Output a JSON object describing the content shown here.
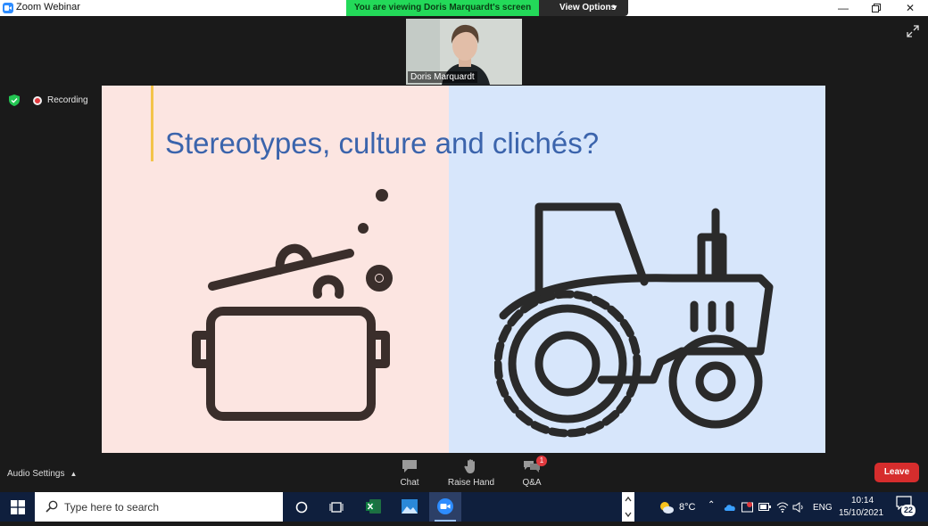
{
  "window": {
    "title": "Zoom Webinar"
  },
  "banner": {
    "viewing_text": "You are viewing Doris Marquardt's screen",
    "view_options_label": "View Options"
  },
  "speaker": {
    "name": "Doris Marquardt"
  },
  "recording": {
    "label": "Recording"
  },
  "slide": {
    "title": "Stereotypes, culture and clichés?"
  },
  "toolbar": {
    "audio_settings_label": "Audio Settings",
    "chat_label": "Chat",
    "raise_hand_label": "Raise Hand",
    "qa_label": "Q&A",
    "qa_badge": "1",
    "leave_label": "Leave"
  },
  "taskbar": {
    "search_placeholder": "Type here to search",
    "weather": "8°C",
    "language": "ENG",
    "time": "10:14",
    "date": "15/10/2021",
    "notification_count": "22"
  },
  "colors": {
    "banner_green": "#23d959",
    "slide_left_bg": "#fce5e1",
    "slide_right_bg": "#d7e6fb",
    "slide_title": "#3b64ac",
    "accent_bar": "#f3c44a",
    "leave_red": "#d62d2d",
    "taskbar_bg": "#0f1f3d"
  }
}
